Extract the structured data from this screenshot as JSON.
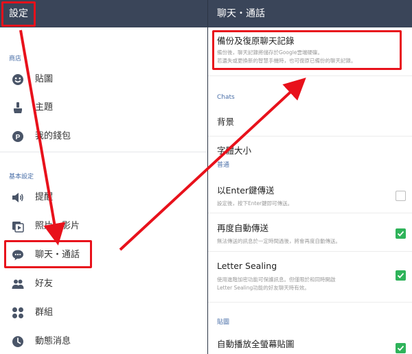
{
  "left_header": {
    "title": "設定"
  },
  "right_header": {
    "title": "聊天・通話"
  },
  "sidebar": {
    "sections": [
      {
        "label": "商店"
      },
      {
        "label": "基本設定"
      }
    ],
    "items": [
      {
        "label": "貼圖",
        "icon": "smiley-icon"
      },
      {
        "label": "主題",
        "icon": "brush-icon"
      },
      {
        "label": "我的錢包",
        "icon": "p-coin-icon"
      },
      {
        "label": "提醒",
        "icon": "speaker-icon"
      },
      {
        "label": "照片・影片",
        "icon": "photo-video-icon"
      },
      {
        "label": "聊天・通話",
        "icon": "chat-bubble-icon"
      },
      {
        "label": "好友",
        "icon": "friends-icon"
      },
      {
        "label": "群組",
        "icon": "groups-icon"
      },
      {
        "label": "動態消息",
        "icon": "clock-icon"
      }
    ]
  },
  "settings": {
    "backup": {
      "title": "備份及復原聊天記錄",
      "desc1": "備份後，聊天記錄將儲存於Google雲端硬碟。",
      "desc2": "若遺失或更換新的智慧手機時，也可復原已備份的聊天記錄。"
    },
    "chats_section": "Chats",
    "background": {
      "title": "背景"
    },
    "font_size": {
      "title": "字體大小"
    },
    "general_section": "普通",
    "enter_send": {
      "title": "以Enter鍵傳送",
      "desc": "設定後，按下Enter鍵即可傳送。",
      "checked": false
    },
    "auto_resend": {
      "title": "再度自動傳送",
      "desc": "無法傳送的訊息於一定時間過後，將會再度自動傳送。",
      "checked": true
    },
    "letter_sealing": {
      "title": "Letter Sealing",
      "desc1": "使用進階加密功能可保護訊息。但僅限於和同時開啟",
      "desc2": "Letter Sealing功能的好友聊天時有效。",
      "checked": true
    },
    "sticker_section": "貼圖",
    "autoplay": {
      "title": "自動播放全螢幕貼圖",
      "checked": true
    }
  },
  "colors": {
    "header_bg": "#3a4559",
    "section_label": "#4a6fa8",
    "checkbox_checked": "#2fb35a",
    "highlight_red": "#e8111b"
  }
}
